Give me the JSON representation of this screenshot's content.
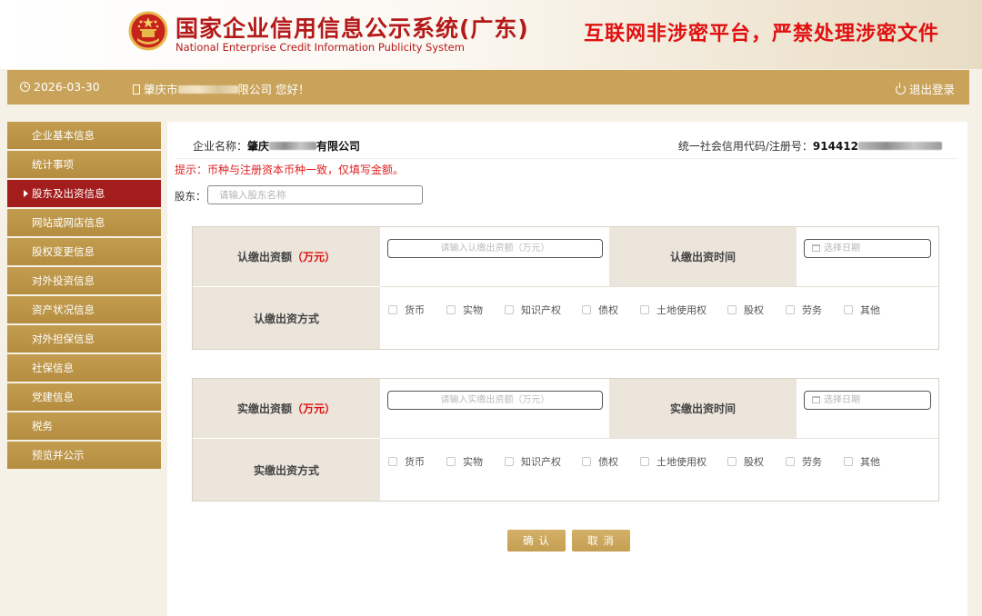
{
  "header": {
    "title_cn": "国家企业信用信息公示系统(广东)",
    "title_en": "National Enterprise Credit Information Publicity System",
    "warning": "互联网非涉密平台，严禁处理涉密文件"
  },
  "topbar": {
    "date": "2026-03-30",
    "greeting_prefix": "肇庆市",
    "greeting_suffix": "限公司 您好！",
    "logout": "退出登录"
  },
  "sidebar": {
    "items": [
      {
        "label": "企业基本信息",
        "active": false
      },
      {
        "label": "统计事项",
        "active": false
      },
      {
        "label": "股东及出资信息",
        "active": true
      },
      {
        "label": "网站或网店信息",
        "active": false
      },
      {
        "label": "股权变更信息",
        "active": false
      },
      {
        "label": "对外投资信息",
        "active": false
      },
      {
        "label": "资产状况信息",
        "active": false
      },
      {
        "label": "对外担保信息",
        "active": false
      },
      {
        "label": "社保信息",
        "active": false
      },
      {
        "label": "党建信息",
        "active": false
      },
      {
        "label": "税务",
        "active": false
      },
      {
        "label": "预览并公示",
        "active": false
      }
    ]
  },
  "main": {
    "company_label": "企业名称：",
    "company_prefix": "肇庆",
    "company_suffix": "有限公司",
    "code_label": "统一社会信用代码/注册号：",
    "code_prefix": "914412",
    "hint": "提示：币种与注册资本币种一致，仅填写金额。",
    "shareholder_label": "股东：",
    "shareholder_placeholder": "请输入股东名称",
    "subscribed": {
      "amount_label": "认缴出资额",
      "amount_unit": "（万元）",
      "amount_placeholder": "请输入认缴出资额（万元）",
      "time_label": "认缴出资时间",
      "date_placeholder": "选择日期",
      "method_label": "认缴出资方式"
    },
    "paid": {
      "amount_label": "实缴出资额",
      "amount_unit": "（万元）",
      "amount_placeholder": "请输入实缴出资额（万元）",
      "time_label": "实缴出资时间",
      "date_placeholder": "选择日期",
      "method_label": "实缴出资方式"
    },
    "methods": [
      "货币",
      "实物",
      "知识产权",
      "债权",
      "土地使用权",
      "股权",
      "劳务",
      "其他"
    ],
    "confirm": "确 认",
    "cancel": "取 消"
  },
  "colors": {
    "brand_red": "#b51a1a",
    "gold": "#c9a35a",
    "active_red": "#a31d1d",
    "warning_red": "#e01010"
  }
}
